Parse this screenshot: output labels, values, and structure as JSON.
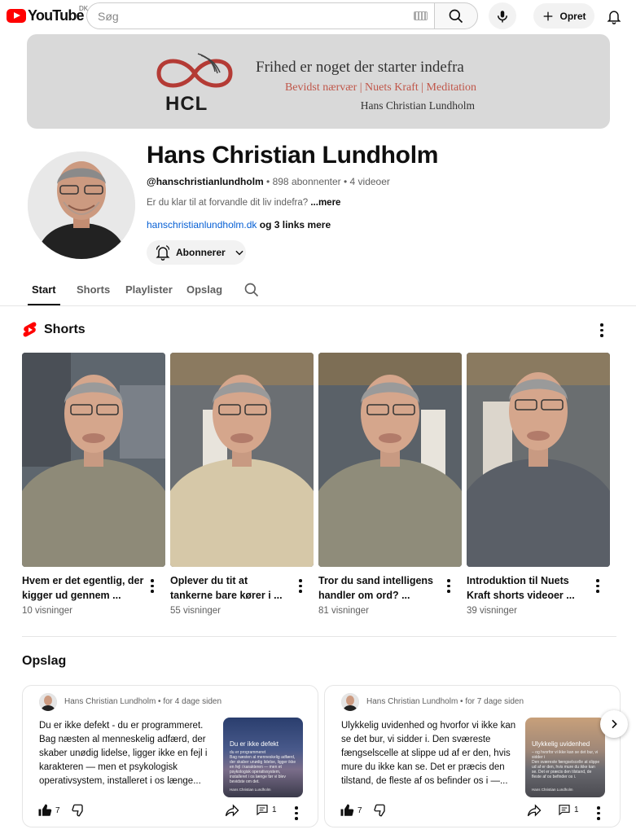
{
  "header": {
    "logo_text": "YouTube",
    "country_code": "DK",
    "search_placeholder": "Søg",
    "create_label": "Opret"
  },
  "banner": {
    "logo_text": "HCL",
    "line1": "Frihed er noget der starter indefra",
    "line2": "Bevidst nærvær | Nuets Kraft | Meditation",
    "line3": "Hans Christian Lundholm"
  },
  "channel": {
    "name": "Hans Christian Lundholm",
    "handle": "@hanschristianlundholm",
    "subscribers": " • 898 abonnenter • 4 videoer",
    "description": "Er du klar til at forvandle dit liv indefra? ",
    "more_label": "...mere",
    "link": "hanschristianlundholm.dk",
    "links_more": " og 3 links mere",
    "subscribe_label": "Abonnerer"
  },
  "tabs": [
    "Start",
    "Shorts",
    "Playlister",
    "Opslag"
  ],
  "shorts": {
    "title": "Shorts",
    "items": [
      {
        "title": "Hvem er det egentlig, der kigger ud gennem ...",
        "views": "10 visninger"
      },
      {
        "title": "Oplever du tit at tankerne bare kører i ...",
        "views": "55 visninger"
      },
      {
        "title": "Tror du sand intelligens handler om ord? ...",
        "views": "81 visninger"
      },
      {
        "title": "Introduktion til Nuets Kraft shorts videoer ...",
        "views": "39 visninger"
      }
    ]
  },
  "posts": {
    "title": "Opslag",
    "items": [
      {
        "author": "Hans Christian Lundholm",
        "time": " • for 4 dage siden",
        "text": "Du er ikke defekt - du er programmeret. Bag næsten al menneskelig adfærd, der skaber unødig lidelse, ligger ikke en fejl i karakteren — men et psykologisk operativsystem, installeret i os længe...",
        "image_title": "Du er ikke defekt",
        "image_subtitle": "du er programmeret",
        "image_body": "Bag næsten al menneskelig adfærd, der skaber unødig lidelse, ligger ikke en fejl i karakteren — men et psykologisk operativsystem, installeret i os længe før vi blev bevidste om det.",
        "image_footer": "Hans Christian Lundholm",
        "likes": "7",
        "comments": "1"
      },
      {
        "author": "Hans Christian Lundholm",
        "time": " • for 7 dage siden",
        "text": "Ulykkelig uvidenhed og hvorfor vi ikke kan se det bur, vi sidder i. Den sværeste fængselscelle at slippe ud af er den, hvis mure du ikke kan se. Det er præcis den tilstand, de fleste af os befinder os i —...",
        "image_title": "Ulykkelig uvidenhed",
        "image_subtitle": "– og hvorfor vi ikke kan se det bur, vi sidder i",
        "image_body": "Den sværeste fængselscelle at slippe ud af er den, hvis mure du ikke kan se. Det er præcis den tilstand, de fleste af os befinder os i.",
        "image_footer": "Hans Christian Lundholm",
        "likes": "7",
        "comments": "1"
      }
    ]
  },
  "colors": {
    "brand_red": "#ff0000",
    "link_blue": "#065fd4",
    "banner_bg": "#d9d9d9",
    "banner_accent": "#c0574a"
  }
}
